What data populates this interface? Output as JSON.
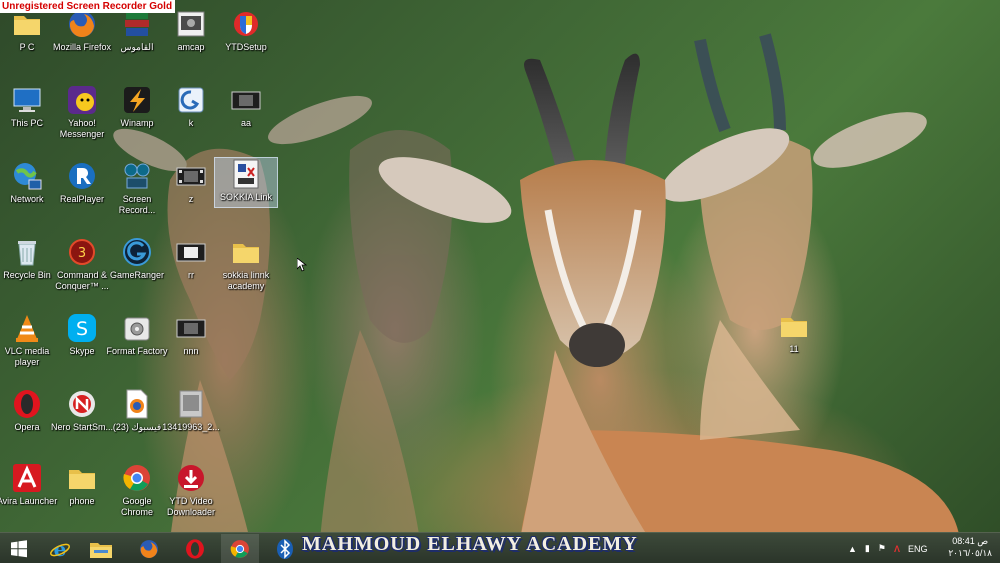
{
  "watermark": "Unregistered Screen Recorder Gold",
  "desktop_icons": [
    {
      "label": "P C",
      "icon": "folder-icon"
    },
    {
      "label": "Mozilla Firefox",
      "icon": "firefox-icon"
    },
    {
      "label": "القاموس",
      "icon": "dictionary-books-icon"
    },
    {
      "label": "amcap",
      "icon": "amcap-icon"
    },
    {
      "label": "YTDSetup",
      "icon": "ytd-setup-shield-icon"
    },
    {
      "label": "This PC",
      "icon": "this-pc-icon"
    },
    {
      "label": "Yahoo! Messenger",
      "icon": "yahoo-messenger-icon"
    },
    {
      "label": "Winamp",
      "icon": "winamp-icon"
    },
    {
      "label": "k",
      "icon": "k-app-icon"
    },
    {
      "label": "aa",
      "icon": "video-file-icon"
    },
    {
      "label": "Network",
      "icon": "network-icon"
    },
    {
      "label": "RealPlayer",
      "icon": "realplayer-icon"
    },
    {
      "label": "Screen Record...",
      "icon": "screen-recorder-icon"
    },
    {
      "label": "z",
      "icon": "video-file-icon"
    },
    {
      "label": "SOKKIA Link",
      "icon": "sokkia-link-icon"
    },
    {
      "label": "Recycle Bin",
      "icon": "recycle-bin-icon"
    },
    {
      "label": "Command & Conquer™ ...",
      "icon": "command-conquer-icon"
    },
    {
      "label": "GameRanger",
      "icon": "gameranger-icon"
    },
    {
      "label": "rr",
      "icon": "video-file-icon"
    },
    {
      "label": "sokkia linnk academy",
      "icon": "folder-icon"
    },
    {
      "label": "VLC media player",
      "icon": "vlc-icon"
    },
    {
      "label": "Skype",
      "icon": "skype-icon"
    },
    {
      "label": "Format Factory",
      "icon": "format-factory-icon"
    },
    {
      "label": "nnn",
      "icon": "video-file-icon"
    },
    {
      "label": "Opera",
      "icon": "opera-icon"
    },
    {
      "label": "Nero StartSm...",
      "icon": "nero-icon"
    },
    {
      "label": "فيسبوك (23)",
      "icon": "firefox-document-icon"
    },
    {
      "label": "13419963_2...",
      "icon": "image-file-icon"
    },
    {
      "label": "Avira Launcher",
      "icon": "avira-icon"
    },
    {
      "label": "phone",
      "icon": "folder-icon"
    },
    {
      "label": "Google Chrome",
      "icon": "chrome-icon"
    },
    {
      "label": "YTD Video Downloader",
      "icon": "ytd-downloader-icon"
    },
    {
      "label": "11",
      "icon": "folder-icon"
    }
  ],
  "selected_icon": "SOKKIA Link",
  "taskbar": {
    "pinned": [
      "start-icon",
      "internet-explorer-icon",
      "file-explorer-icon",
      "firefox-icon",
      "opera-icon",
      "chrome-icon",
      "bluetooth-icon"
    ],
    "active": "chrome-icon",
    "overlay_text": "MAHMOUD ELHAWY ACADEMY",
    "language": "ENG",
    "time": "08:41 ص",
    "date": "٢٠١٦/٠٥/١٨"
  }
}
